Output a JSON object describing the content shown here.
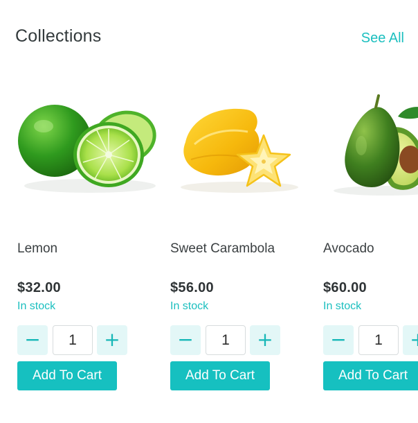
{
  "section": {
    "title": "Collections",
    "see_all_label": "See All"
  },
  "products": [
    {
      "name": "Lemon",
      "price": "$32.00",
      "stock": "In stock",
      "quantity": "1",
      "minus_symbol": "−",
      "plus_symbol": "+",
      "add_label": "Add To Cart",
      "image_icon": "lime-fruit-image"
    },
    {
      "name": "Sweet Carambola",
      "price": "$56.00",
      "stock": "In stock",
      "quantity": "1",
      "minus_symbol": "−",
      "plus_symbol": "+",
      "add_label": "Add To Cart",
      "image_icon": "carambola-fruit-image"
    },
    {
      "name": "Avocado",
      "price": "$60.00",
      "stock": "In stock",
      "quantity": "1",
      "minus_symbol": "−",
      "plus_symbol": "+",
      "add_label": "Add To Cart",
      "image_icon": "avocado-fruit-image"
    }
  ],
  "colors": {
    "accent": "#16c0c0",
    "accent_light": "#e3f7f7",
    "text": "#333a3c"
  }
}
